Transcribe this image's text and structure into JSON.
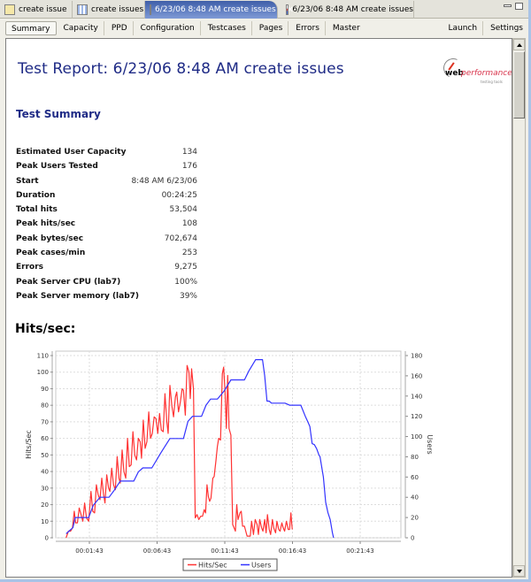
{
  "editor_tabs": [
    {
      "label": "create issue",
      "icon": "testcase-icon",
      "active": false
    },
    {
      "label": "create issues",
      "icon": "load-config-icon",
      "active": false
    },
    {
      "label": "6/23/06 8:48 AM create issues",
      "icon": "report-icon",
      "active": true,
      "closable": true
    },
    {
      "label": "6/23/06 8:48 AM create issues",
      "icon": "report-icon",
      "active": false
    }
  ],
  "nav": {
    "left": [
      "Summary",
      "Capacity",
      "PPD",
      "Configuration",
      "Testcases",
      "Pages",
      "Errors",
      "Master"
    ],
    "right": [
      "Launch",
      "Settings"
    ],
    "active": "Summary"
  },
  "report": {
    "title": "Test Report: 6/23/06 8:48 AM create issues",
    "logo": {
      "brand_bold": "web",
      "brand_italic": "performance",
      "tagline": "testing tools"
    },
    "section_title": "Test Summary",
    "summary": [
      {
        "label": "Estimated User Capacity",
        "value": "134"
      },
      {
        "label": "Peak Users Tested",
        "value": "176"
      },
      {
        "label": "Start",
        "value": "8:48 AM 6/23/06"
      },
      {
        "label": "Duration",
        "value": "00:24:25"
      },
      {
        "label": "Total hits",
        "value": "53,504"
      },
      {
        "label": "Peak hits/sec",
        "value": "108"
      },
      {
        "label": "Peak bytes/sec",
        "value": "702,674"
      },
      {
        "label": "Peak cases/min",
        "value": "253"
      },
      {
        "label": "Errors",
        "value": "9,275"
      },
      {
        "label": "Peak Server CPU (lab7)",
        "value": "100%"
      },
      {
        "label": "Peak Server memory (lab7)",
        "value": "39%"
      }
    ],
    "chart_heading": "Hits/sec:"
  },
  "colors": {
    "title": "#1f2b86",
    "hits": "#ff3333",
    "users": "#3333ff"
  },
  "chart_data": {
    "type": "line",
    "title": "Hits/sec:",
    "xlabel": "",
    "ylabel": "Hits/Sec",
    "y2label": "Users",
    "x_unit": "elapsed seconds",
    "x_ticks": [
      {
        "value": 103,
        "label": "00:01:43"
      },
      {
        "value": 403,
        "label": "00:06:43"
      },
      {
        "value": 703,
        "label": "00:11:43"
      },
      {
        "value": 1003,
        "label": "00:16:43"
      },
      {
        "value": 1303,
        "label": "00:21:43"
      }
    ],
    "xlim": [
      0,
      1480
    ],
    "ylim": [
      0,
      110
    ],
    "y_ticks": [
      0,
      10,
      20,
      30,
      40,
      50,
      60,
      70,
      80,
      90,
      100,
      110
    ],
    "y2lim": [
      0,
      180
    ],
    "y2_ticks": [
      0,
      20,
      40,
      60,
      80,
      100,
      120,
      140,
      160,
      180
    ],
    "grid": true,
    "legend": "bottom-center",
    "series": [
      {
        "name": "Hits/Sec",
        "axis": "left",
        "color": "#ff3333",
        "points": [
          [
            0,
            0
          ],
          [
            10,
            4
          ],
          [
            20,
            4
          ],
          [
            28,
            6
          ],
          [
            36,
            16
          ],
          [
            42,
            9
          ],
          [
            50,
            9
          ],
          [
            58,
            18
          ],
          [
            66,
            14
          ],
          [
            74,
            10
          ],
          [
            82,
            21
          ],
          [
            90,
            12
          ],
          [
            100,
            10
          ],
          [
            110,
            28
          ],
          [
            118,
            16
          ],
          [
            126,
            15
          ],
          [
            134,
            32
          ],
          [
            142,
            26
          ],
          [
            150,
            23
          ],
          [
            158,
            36
          ],
          [
            166,
            26
          ],
          [
            172,
            21
          ],
          [
            180,
            38
          ],
          [
            188,
            30
          ],
          [
            194,
            28
          ],
          [
            202,
            42
          ],
          [
            210,
            32
          ],
          [
            218,
            29
          ],
          [
            226,
            49
          ],
          [
            234,
            36
          ],
          [
            240,
            33
          ],
          [
            248,
            53
          ],
          [
            256,
            40
          ],
          [
            264,
            36
          ],
          [
            272,
            60
          ],
          [
            280,
            43
          ],
          [
            288,
            44
          ],
          [
            296,
            64
          ],
          [
            304,
            50
          ],
          [
            312,
            47
          ],
          [
            320,
            60
          ],
          [
            328,
            58
          ],
          [
            334,
            48
          ],
          [
            342,
            71
          ],
          [
            350,
            54
          ],
          [
            358,
            58
          ],
          [
            366,
            76
          ],
          [
            374,
            60
          ],
          [
            382,
            63
          ],
          [
            390,
            73
          ],
          [
            398,
            72
          ],
          [
            406,
            63
          ],
          [
            414,
            75
          ],
          [
            422,
            65
          ],
          [
            430,
            64
          ],
          [
            438,
            87
          ],
          [
            446,
            70
          ],
          [
            452,
            63
          ],
          [
            460,
            92
          ],
          [
            468,
            80
          ],
          [
            476,
            73
          ],
          [
            484,
            85
          ],
          [
            490,
            88
          ],
          [
            498,
            76
          ],
          [
            506,
            82
          ],
          [
            514,
            90
          ],
          [
            520,
            89
          ],
          [
            528,
            74
          ],
          [
            536,
            104
          ],
          [
            544,
            100
          ],
          [
            550,
            84
          ],
          [
            556,
            102
          ],
          [
            564,
            90
          ],
          [
            572,
            12
          ],
          [
            580,
            14
          ],
          [
            588,
            11
          ],
          [
            596,
            13
          ],
          [
            604,
            13
          ],
          [
            612,
            17
          ],
          [
            618,
            15
          ],
          [
            624,
            32
          ],
          [
            630,
            25
          ],
          [
            636,
            22
          ],
          [
            642,
            24
          ],
          [
            650,
            36
          ],
          [
            656,
            37
          ],
          [
            664,
            47
          ],
          [
            670,
            55
          ],
          [
            676,
            60
          ],
          [
            684,
            59
          ],
          [
            692,
            99
          ],
          [
            698,
            103
          ],
          [
            704,
            88
          ],
          [
            710,
            66
          ],
          [
            716,
            98
          ],
          [
            722,
            66
          ],
          [
            730,
            62
          ],
          [
            738,
            8
          ],
          [
            744,
            6
          ],
          [
            750,
            4
          ],
          [
            756,
            20
          ],
          [
            762,
            11
          ],
          [
            770,
            15
          ],
          [
            776,
            16
          ],
          [
            782,
            7
          ],
          [
            790,
            7
          ],
          [
            796,
            4
          ],
          [
            802,
            1
          ],
          [
            808,
            1
          ],
          [
            816,
            1
          ],
          [
            822,
            10
          ],
          [
            830,
            2
          ],
          [
            838,
            11
          ],
          [
            846,
            8
          ],
          [
            852,
            2
          ],
          [
            858,
            11
          ],
          [
            866,
            6
          ],
          [
            872,
            4
          ],
          [
            880,
            11
          ],
          [
            886,
            3
          ],
          [
            892,
            14
          ],
          [
            900,
            5
          ],
          [
            906,
            2
          ],
          [
            914,
            11
          ],
          [
            920,
            6
          ],
          [
            928,
            3
          ],
          [
            934,
            10
          ],
          [
            942,
            5
          ],
          [
            948,
            4
          ],
          [
            956,
            9
          ],
          [
            962,
            6
          ],
          [
            968,
            4
          ],
          [
            976,
            10
          ],
          [
            984,
            5
          ],
          [
            990,
            5
          ],
          [
            996,
            15
          ],
          [
            1002,
            5
          ]
        ]
      },
      {
        "name": "Users",
        "axis": "right",
        "color": "#3333ff",
        "points": [
          [
            0,
            4
          ],
          [
            20,
            8
          ],
          [
            30,
            10
          ],
          [
            40,
            20
          ],
          [
            80,
            20
          ],
          [
            100,
            20
          ],
          [
            120,
            32
          ],
          [
            150,
            40
          ],
          [
            190,
            40
          ],
          [
            210,
            46
          ],
          [
            240,
            56
          ],
          [
            300,
            56
          ],
          [
            320,
            65
          ],
          [
            340,
            69
          ],
          [
            380,
            69
          ],
          [
            420,
            84
          ],
          [
            460,
            98
          ],
          [
            520,
            98
          ],
          [
            540,
            115
          ],
          [
            560,
            120
          ],
          [
            600,
            120
          ],
          [
            620,
            131
          ],
          [
            640,
            137
          ],
          [
            670,
            137
          ],
          [
            700,
            145
          ],
          [
            730,
            156
          ],
          [
            790,
            156
          ],
          [
            810,
            165
          ],
          [
            840,
            176
          ],
          [
            870,
            176
          ],
          [
            880,
            160
          ],
          [
            890,
            135
          ],
          [
            900,
            135
          ],
          [
            910,
            133
          ],
          [
            970,
            133
          ],
          [
            990,
            131
          ],
          [
            1040,
            131
          ],
          [
            1060,
            120
          ],
          [
            1070,
            115
          ],
          [
            1080,
            110
          ],
          [
            1090,
            93
          ],
          [
            1100,
            92
          ],
          [
            1110,
            88
          ],
          [
            1120,
            82
          ],
          [
            1125,
            80
          ],
          [
            1140,
            60
          ],
          [
            1150,
            35
          ],
          [
            1160,
            25
          ],
          [
            1170,
            18
          ],
          [
            1180,
            5
          ],
          [
            1185,
            0
          ]
        ]
      }
    ]
  }
}
